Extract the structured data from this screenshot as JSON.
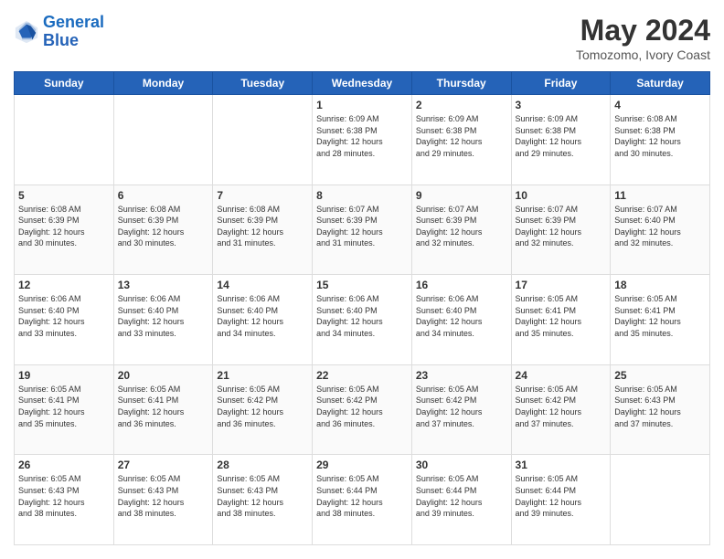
{
  "header": {
    "logo_line1": "General",
    "logo_line2": "Blue",
    "month": "May 2024",
    "location": "Tomozomo, Ivory Coast"
  },
  "weekdays": [
    "Sunday",
    "Monday",
    "Tuesday",
    "Wednesday",
    "Thursday",
    "Friday",
    "Saturday"
  ],
  "weeks": [
    [
      {
        "day": "",
        "info": ""
      },
      {
        "day": "",
        "info": ""
      },
      {
        "day": "",
        "info": ""
      },
      {
        "day": "1",
        "info": "Sunrise: 6:09 AM\nSunset: 6:38 PM\nDaylight: 12 hours\nand 28 minutes."
      },
      {
        "day": "2",
        "info": "Sunrise: 6:09 AM\nSunset: 6:38 PM\nDaylight: 12 hours\nand 29 minutes."
      },
      {
        "day": "3",
        "info": "Sunrise: 6:09 AM\nSunset: 6:38 PM\nDaylight: 12 hours\nand 29 minutes."
      },
      {
        "day": "4",
        "info": "Sunrise: 6:08 AM\nSunset: 6:38 PM\nDaylight: 12 hours\nand 30 minutes."
      }
    ],
    [
      {
        "day": "5",
        "info": "Sunrise: 6:08 AM\nSunset: 6:39 PM\nDaylight: 12 hours\nand 30 minutes."
      },
      {
        "day": "6",
        "info": "Sunrise: 6:08 AM\nSunset: 6:39 PM\nDaylight: 12 hours\nand 30 minutes."
      },
      {
        "day": "7",
        "info": "Sunrise: 6:08 AM\nSunset: 6:39 PM\nDaylight: 12 hours\nand 31 minutes."
      },
      {
        "day": "8",
        "info": "Sunrise: 6:07 AM\nSunset: 6:39 PM\nDaylight: 12 hours\nand 31 minutes."
      },
      {
        "day": "9",
        "info": "Sunrise: 6:07 AM\nSunset: 6:39 PM\nDaylight: 12 hours\nand 32 minutes."
      },
      {
        "day": "10",
        "info": "Sunrise: 6:07 AM\nSunset: 6:39 PM\nDaylight: 12 hours\nand 32 minutes."
      },
      {
        "day": "11",
        "info": "Sunrise: 6:07 AM\nSunset: 6:40 PM\nDaylight: 12 hours\nand 32 minutes."
      }
    ],
    [
      {
        "day": "12",
        "info": "Sunrise: 6:06 AM\nSunset: 6:40 PM\nDaylight: 12 hours\nand 33 minutes."
      },
      {
        "day": "13",
        "info": "Sunrise: 6:06 AM\nSunset: 6:40 PM\nDaylight: 12 hours\nand 33 minutes."
      },
      {
        "day": "14",
        "info": "Sunrise: 6:06 AM\nSunset: 6:40 PM\nDaylight: 12 hours\nand 34 minutes."
      },
      {
        "day": "15",
        "info": "Sunrise: 6:06 AM\nSunset: 6:40 PM\nDaylight: 12 hours\nand 34 minutes."
      },
      {
        "day": "16",
        "info": "Sunrise: 6:06 AM\nSunset: 6:40 PM\nDaylight: 12 hours\nand 34 minutes."
      },
      {
        "day": "17",
        "info": "Sunrise: 6:05 AM\nSunset: 6:41 PM\nDaylight: 12 hours\nand 35 minutes."
      },
      {
        "day": "18",
        "info": "Sunrise: 6:05 AM\nSunset: 6:41 PM\nDaylight: 12 hours\nand 35 minutes."
      }
    ],
    [
      {
        "day": "19",
        "info": "Sunrise: 6:05 AM\nSunset: 6:41 PM\nDaylight: 12 hours\nand 35 minutes."
      },
      {
        "day": "20",
        "info": "Sunrise: 6:05 AM\nSunset: 6:41 PM\nDaylight: 12 hours\nand 36 minutes."
      },
      {
        "day": "21",
        "info": "Sunrise: 6:05 AM\nSunset: 6:42 PM\nDaylight: 12 hours\nand 36 minutes."
      },
      {
        "day": "22",
        "info": "Sunrise: 6:05 AM\nSunset: 6:42 PM\nDaylight: 12 hours\nand 36 minutes."
      },
      {
        "day": "23",
        "info": "Sunrise: 6:05 AM\nSunset: 6:42 PM\nDaylight: 12 hours\nand 37 minutes."
      },
      {
        "day": "24",
        "info": "Sunrise: 6:05 AM\nSunset: 6:42 PM\nDaylight: 12 hours\nand 37 minutes."
      },
      {
        "day": "25",
        "info": "Sunrise: 6:05 AM\nSunset: 6:43 PM\nDaylight: 12 hours\nand 37 minutes."
      }
    ],
    [
      {
        "day": "26",
        "info": "Sunrise: 6:05 AM\nSunset: 6:43 PM\nDaylight: 12 hours\nand 38 minutes."
      },
      {
        "day": "27",
        "info": "Sunrise: 6:05 AM\nSunset: 6:43 PM\nDaylight: 12 hours\nand 38 minutes."
      },
      {
        "day": "28",
        "info": "Sunrise: 6:05 AM\nSunset: 6:43 PM\nDaylight: 12 hours\nand 38 minutes."
      },
      {
        "day": "29",
        "info": "Sunrise: 6:05 AM\nSunset: 6:44 PM\nDaylight: 12 hours\nand 38 minutes."
      },
      {
        "day": "30",
        "info": "Sunrise: 6:05 AM\nSunset: 6:44 PM\nDaylight: 12 hours\nand 39 minutes."
      },
      {
        "day": "31",
        "info": "Sunrise: 6:05 AM\nSunset: 6:44 PM\nDaylight: 12 hours\nand 39 minutes."
      },
      {
        "day": "",
        "info": ""
      }
    ]
  ]
}
